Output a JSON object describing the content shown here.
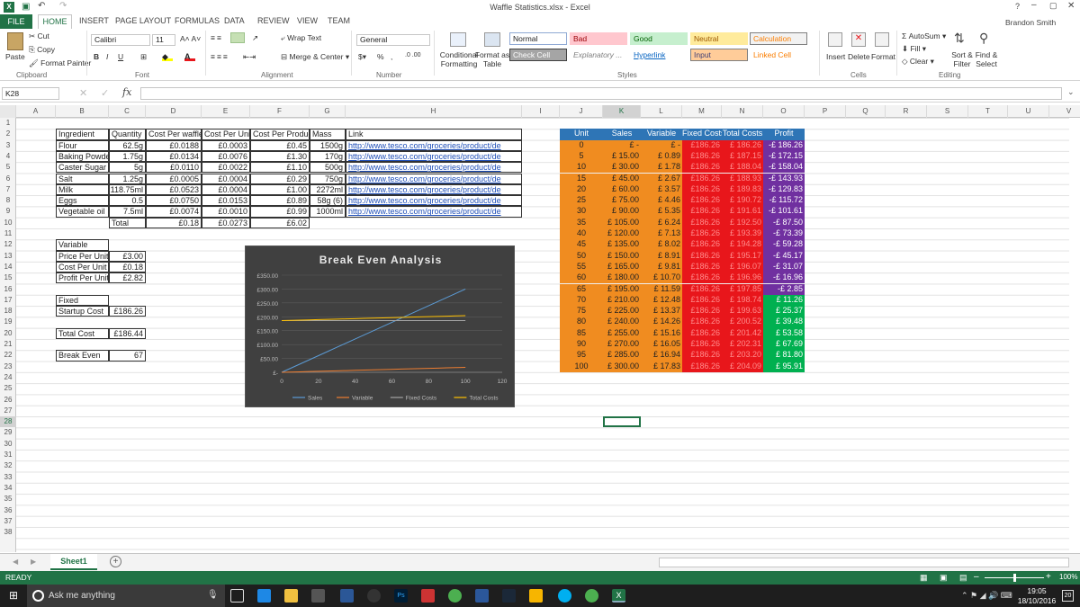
{
  "window": {
    "title": "Waffle Statistics.xlsx - Excel",
    "user": "Brandon Smith",
    "help": "?"
  },
  "ribbon_tabs": [
    "FILE",
    "HOME",
    "INSERT",
    "PAGE LAYOUT",
    "FORMULAS",
    "DATA",
    "REVIEW",
    "VIEW",
    "TEAM"
  ],
  "clipboard": {
    "paste": "Paste",
    "cut": "Cut",
    "copy": "Copy",
    "format_painter": "Format Painter",
    "group": "Clipboard"
  },
  "font": {
    "name": "Calibri",
    "size": "11",
    "bold": "B",
    "italic": "I",
    "underline": "U",
    "group": "Font"
  },
  "alignment": {
    "wrap": "Wrap Text",
    "merge": "Merge & Center",
    "group": "Alignment"
  },
  "number": {
    "format": "General",
    "group": "Number",
    "percent": "%"
  },
  "styles": {
    "conditional": "Conditional Formatting",
    "format_table": "Format as Table",
    "cells": [
      {
        "label": "Normal",
        "bg": "#ffffff",
        "fg": "#222222",
        "border": "#8fa9d4"
      },
      {
        "label": "Bad",
        "bg": "#ffc7ce",
        "fg": "#9c0006",
        "border": "#ffc7ce"
      },
      {
        "label": "Good",
        "bg": "#c6efce",
        "fg": "#006100",
        "border": "#c6efce"
      },
      {
        "label": "Neutral",
        "bg": "#ffeb9c",
        "fg": "#9c5700",
        "border": "#ffeb9c"
      },
      {
        "label": "Calculation",
        "bg": "#f2f2f2",
        "fg": "#fa7d00",
        "border": "#7f7f7f"
      },
      {
        "label": "Check Cell",
        "bg": "#a5a5a5",
        "fg": "#ffffff",
        "border": "#3f3f3f"
      },
      {
        "label": "Explanatory ...",
        "bg": "#ffffff",
        "fg": "#7f7f7f",
        "border": "#ffffff"
      },
      {
        "label": "Hyperlink",
        "bg": "#ffffff",
        "fg": "#0563c1",
        "border": "#ffffff"
      },
      {
        "label": "Input",
        "bg": "#ffcc99",
        "fg": "#3f3f76",
        "border": "#7f7f7f"
      },
      {
        "label": "Linked Cell",
        "bg": "#ffffff",
        "fg": "#fa7d00",
        "border": "#ffffff"
      }
    ],
    "group": "Styles"
  },
  "cells_group": {
    "insert": "Insert",
    "delete": "Delete",
    "format": "Format",
    "group": "Cells"
  },
  "editing": {
    "autosum": "AutoSum",
    "fill": "Fill",
    "clear": "Clear",
    "sort": "Sort & Filter",
    "find": "Find & Select",
    "group": "Editing"
  },
  "formula_bar": {
    "name_box": "K28",
    "fx": "fx",
    "value": ""
  },
  "columns": [
    "A",
    "B",
    "C",
    "D",
    "E",
    "F",
    "G",
    "H",
    "I",
    "J",
    "K",
    "L",
    "M",
    "N",
    "O",
    "P",
    "Q",
    "R",
    "S",
    "T",
    "U",
    "V"
  ],
  "rows": [
    "1",
    "2",
    "3",
    "4",
    "5",
    "6",
    "7",
    "8",
    "9",
    "10",
    "11",
    "12",
    "13",
    "14",
    "15",
    "16",
    "17",
    "18",
    "19",
    "20",
    "21",
    "22",
    "23",
    "24",
    "25",
    "26",
    "27",
    "28",
    "29",
    "30",
    "31",
    "32",
    "33",
    "34",
    "35",
    "36",
    "37",
    "38"
  ],
  "ingredients": {
    "headers": [
      "Ingredient",
      "Quantity",
      "Cost Per waffle",
      "Cost Per Unit",
      "Cost Per Product",
      "Mass",
      "Link"
    ],
    "rows": [
      [
        "Flour",
        "62.5g",
        "£0.0188",
        "£0.0003",
        "£0.45",
        "1500g",
        "http://www.tesco.com/groceries/product/de"
      ],
      [
        "Baking Powder",
        "1.75g",
        "£0.0134",
        "£0.0076",
        "£1.30",
        "170g",
        "http://www.tesco.com/groceries/product/de"
      ],
      [
        "Caster Sugar",
        "5g",
        "£0.0110",
        "£0.0022",
        "£1.10",
        "500g",
        "http://www.tesco.com/groceries/product/de"
      ],
      [
        "Salt",
        "1.25g",
        "£0.0005",
        "£0.0004",
        "£0.29",
        "750g",
        "http://www.tesco.com/groceries/product/de"
      ],
      [
        "Milk",
        "118.75ml",
        "£0.0523",
        "£0.0004",
        "£1.00",
        "2272ml",
        "http://www.tesco.com/groceries/product/de"
      ],
      [
        "Eggs",
        "0.5",
        "£0.0750",
        "£0.0153",
        "£0.89",
        "58g (6)",
        "http://www.tesco.com/groceries/product/de"
      ],
      [
        "Vegetable oil",
        "7.5ml",
        "£0.0074",
        "£0.0010",
        "£0.99",
        "1000ml",
        "http://www.tesco.com/groceries/product/de"
      ]
    ],
    "total": [
      "Total",
      "£0.18",
      "£0.0273",
      "£6.02"
    ]
  },
  "summary": {
    "variable": "Variable",
    "price_label": "Price Per Unit",
    "price": "£3.00",
    "cost_label": "Cost Per Unit",
    "cost": "£0.18",
    "profit_label": "Profit Per Unit",
    "profit": "£2.82",
    "fixed": "Fixed",
    "startup_label": "Startup Cost",
    "startup": "£186.26",
    "total_label": "Total Cost",
    "total": "£186.44",
    "be_label": "Break Even",
    "be": "67"
  },
  "breakeven_table": {
    "headers": [
      "Unit",
      "Sales",
      "Variable",
      "Fixed Costs",
      "Total Costs",
      "Profit"
    ],
    "rows": [
      [
        "0",
        "£ -",
        "£ -",
        "£186.26",
        "£ 186.26",
        "-£ 186.26"
      ],
      [
        "5",
        "£ 15.00",
        "£ 0.89",
        "£186.26",
        "£ 187.15",
        "-£ 172.15"
      ],
      [
        "10",
        "£ 30.00",
        "£ 1.78",
        "£186.26",
        "£ 188.04",
        "-£ 158.04"
      ],
      [
        "15",
        "£ 45.00",
        "£ 2.67",
        "£186.26",
        "£ 188.93",
        "-£ 143.93"
      ],
      [
        "20",
        "£ 60.00",
        "£ 3.57",
        "£186.26",
        "£ 189.83",
        "-£ 129.83"
      ],
      [
        "25",
        "£ 75.00",
        "£ 4.46",
        "£186.26",
        "£ 190.72",
        "-£ 115.72"
      ],
      [
        "30",
        "£ 90.00",
        "£ 5.35",
        "£186.26",
        "£ 191.61",
        "-£ 101.61"
      ],
      [
        "35",
        "£ 105.00",
        "£ 6.24",
        "£186.26",
        "£ 192.50",
        "-£ 87.50"
      ],
      [
        "40",
        "£ 120.00",
        "£ 7.13",
        "£186.26",
        "£ 193.39",
        "-£ 73.39"
      ],
      [
        "45",
        "£ 135.00",
        "£ 8.02",
        "£186.26",
        "£ 194.28",
        "-£ 59.28"
      ],
      [
        "50",
        "£ 150.00",
        "£ 8.91",
        "£186.26",
        "£ 195.17",
        "-£ 45.17"
      ],
      [
        "55",
        "£ 165.00",
        "£ 9.81",
        "£186.26",
        "£ 196.07",
        "-£ 31.07"
      ],
      [
        "60",
        "£ 180.00",
        "£ 10.70",
        "£186.26",
        "£ 196.96",
        "-£ 16.96"
      ],
      [
        "65",
        "£ 195.00",
        "£ 11.59",
        "£186.26",
        "£ 197.85",
        "-£ 2.85"
      ],
      [
        "70",
        "£ 210.00",
        "£ 12.48",
        "£186.26",
        "£ 198.74",
        "£ 11.26"
      ],
      [
        "75",
        "£ 225.00",
        "£ 13.37",
        "£186.26",
        "£ 199.63",
        "£ 25.37"
      ],
      [
        "80",
        "£ 240.00",
        "£ 14.26",
        "£186.26",
        "£ 200.52",
        "£ 39.48"
      ],
      [
        "85",
        "£ 255.00",
        "£ 15.16",
        "£186.26",
        "£ 201.42",
        "£ 53.58"
      ],
      [
        "90",
        "£ 270.00",
        "£ 16.05",
        "£186.26",
        "£ 202.31",
        "£ 67.69"
      ],
      [
        "95",
        "£ 285.00",
        "£ 16.94",
        "£186.26",
        "£ 203.20",
        "£ 81.80"
      ],
      [
        "100",
        "£ 300.00",
        "£ 17.83",
        "£186.26",
        "£ 204.09",
        "£ 95.91"
      ]
    ],
    "colors": {
      "header": "#2e75b6",
      "orange": "#f08c20",
      "red": "#e8161b",
      "purple": "#7030a0",
      "green": "#00b050"
    }
  },
  "chart_data": {
    "type": "line",
    "title": "Break Even Analysis",
    "x": [
      0,
      5,
      10,
      15,
      20,
      25,
      30,
      35,
      40,
      45,
      50,
      55,
      60,
      65,
      70,
      75,
      80,
      85,
      90,
      95,
      100
    ],
    "series": [
      {
        "name": "Sales",
        "color": "#5b9bd5",
        "values": [
          0,
          15,
          30,
          45,
          60,
          75,
          90,
          105,
          120,
          135,
          150,
          165,
          180,
          195,
          210,
          225,
          240,
          255,
          270,
          285,
          300
        ]
      },
      {
        "name": "Variable",
        "color": "#ed7d31",
        "values": [
          0,
          0.89,
          1.78,
          2.67,
          3.57,
          4.46,
          5.35,
          6.24,
          7.13,
          8.02,
          8.91,
          9.81,
          10.7,
          11.59,
          12.48,
          13.37,
          14.26,
          15.16,
          16.05,
          16.94,
          17.83
        ]
      },
      {
        "name": "Fixed Costs",
        "color": "#a5a5a5",
        "values": [
          186.26,
          186.26,
          186.26,
          186.26,
          186.26,
          186.26,
          186.26,
          186.26,
          186.26,
          186.26,
          186.26,
          186.26,
          186.26,
          186.26,
          186.26,
          186.26,
          186.26,
          186.26,
          186.26,
          186.26,
          186.26
        ]
      },
      {
        "name": "Total Costs",
        "color": "#ffc000",
        "values": [
          186.26,
          187.15,
          188.04,
          188.93,
          189.83,
          190.72,
          191.61,
          192.5,
          193.39,
          194.28,
          195.17,
          196.07,
          196.96,
          197.85,
          198.74,
          199.63,
          200.52,
          201.42,
          202.31,
          203.2,
          204.09
        ]
      }
    ],
    "yticks": [
      "£350.00",
      "£300.00",
      "£250.00",
      "£200.00",
      "£150.00",
      "£100.00",
      "£50.00",
      "£-"
    ],
    "xticks": [
      "0",
      "20",
      "40",
      "60",
      "80",
      "100",
      "120"
    ],
    "xlim": [
      0,
      120
    ],
    "ylim": [
      0,
      350
    ],
    "grid": true,
    "legend": "bottom"
  },
  "sheet_tabs": [
    "Sheet1"
  ],
  "status": {
    "ready": "READY",
    "zoom": "100%"
  },
  "taskbar": {
    "search": "Ask me anything",
    "time": "19:05",
    "date": "18/10/2016"
  }
}
